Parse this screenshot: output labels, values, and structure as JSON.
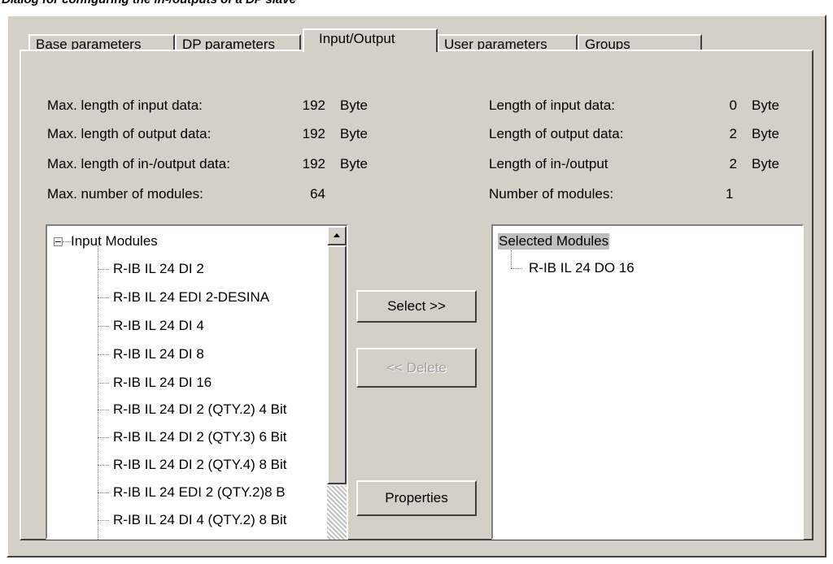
{
  "caption": "Dialog for configuring the in-/outputs of a DP slave",
  "tabs": [
    "Base parameters",
    "DP parameters",
    "Input/Output",
    "User parameters",
    "Groups"
  ],
  "active_tab": "Input/Output",
  "left_info": [
    {
      "label": "Max. length of input data:",
      "value": "192",
      "unit": "Byte"
    },
    {
      "label": "Max. length of output data:",
      "value": "192",
      "unit": "Byte"
    },
    {
      "label": "Max. length of in-/output data:",
      "value": "192",
      "unit": "Byte"
    },
    {
      "label": "Max. number of modules:",
      "value": "64",
      "unit": ""
    }
  ],
  "right_info": [
    {
      "label": "Length of input data:",
      "value": "0",
      "unit": "Byte"
    },
    {
      "label": "Length of output data:",
      "value": "2",
      "unit": "Byte"
    },
    {
      "label": "Length of in-/output",
      "value": "2",
      "unit": "Byte"
    },
    {
      "label": "Number of modules:",
      "value": "1",
      "unit": ""
    }
  ],
  "input_tree": {
    "root": "Input Modules",
    "items": [
      "R-IB IL 24 DI 2",
      "R-IB IL 24 EDI 2-DESINA",
      "R-IB IL 24 DI 4",
      "R-IB IL 24 DI 8",
      "R-IB IL 24 DI 16",
      "R-IB IL 24 DI 2 (QTY.2) 4 Bit",
      "R-IB IL 24 DI 2 (QTY.3) 6 Bit",
      "R-IB IL 24 DI 2 (QTY.4) 8 Bit",
      "R-IB IL 24 EDI 2 (QTY.2)8 B",
      "R-IB IL 24 DI 4 (QTY.2) 8 Bit"
    ]
  },
  "selected_tree": {
    "root": "Selected Modules",
    "items": [
      "R-IB IL 24 DO 16"
    ]
  },
  "buttons": {
    "select": "Select >>",
    "delete": "<< Delete",
    "properties": "Properties"
  }
}
